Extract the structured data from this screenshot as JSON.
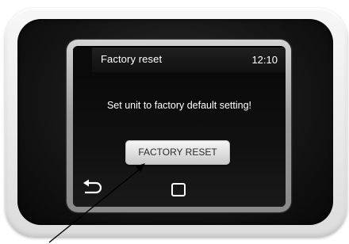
{
  "header": {
    "title": "Factory reset",
    "time": "12:10"
  },
  "main": {
    "message": "Set unit to factory default setting!",
    "reset_button_label": "FACTORY RESET"
  },
  "nav": {
    "back_icon": "back-arrow-icon",
    "home_icon": "home-square-icon"
  }
}
